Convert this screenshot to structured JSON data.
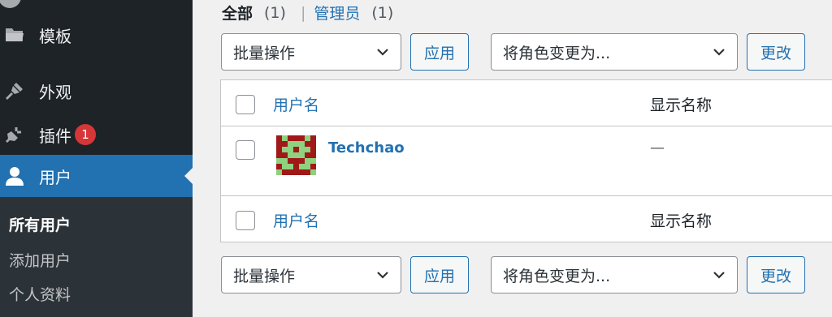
{
  "sidebar": {
    "items": [
      {
        "label": "模板",
        "icon": "folder-icon"
      },
      {
        "label": "外观",
        "icon": "paintbrush-icon"
      },
      {
        "label": "插件",
        "icon": "plugin-icon",
        "badge": "1"
      },
      {
        "label": "用户",
        "icon": "user-icon",
        "active": true
      }
    ],
    "submenu": [
      {
        "label": "所有用户",
        "current": true
      },
      {
        "label": "添加用户"
      },
      {
        "label": "个人资料"
      }
    ]
  },
  "filters": {
    "all_label": "全部",
    "all_count": "(1)",
    "separator": "|",
    "admin_label": "管理员",
    "admin_count": "(1)"
  },
  "actions_top": {
    "bulk_select": "批量操作",
    "apply": "应用",
    "role_select": "将角色变更为...",
    "change": "更改"
  },
  "actions_bottom": {
    "bulk_select": "批量操作",
    "apply": "应用",
    "role_select": "将角色变更为...",
    "change": "更改"
  },
  "table": {
    "columns": [
      "用户名",
      "显示名称"
    ],
    "rows": [
      {
        "username": "Techchao",
        "display_name": "—",
        "avatar": "pixel-avatar"
      }
    ]
  },
  "colors": {
    "sidebar_bg": "#1d2327",
    "accent": "#2271b1",
    "badge": "#d63638",
    "avatar_bg": "#a01818",
    "avatar_fg": "#8ed17e"
  }
}
